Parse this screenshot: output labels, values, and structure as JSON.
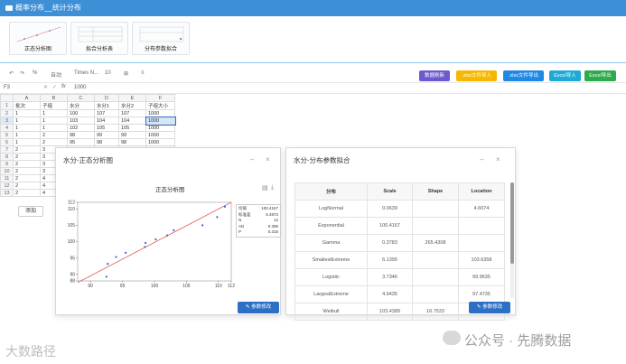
{
  "window_title": "概率分布__统计分布",
  "cards": [
    {
      "label": "正态分析图"
    },
    {
      "label": "拟合分析表"
    },
    {
      "label": "分布参数拟合"
    }
  ],
  "toolbar": {
    "font_name": "Times N...",
    "font_size": "10",
    "auto_label": "自动",
    "percent": "%"
  },
  "buttons": {
    "refresh": "数据刷新",
    "xlsx_import": ".xlsx文件导入",
    "xlsx_export": ".xlsx文件导出",
    "excel_import": "Excel导入",
    "excel_export": "Excel导出"
  },
  "formula_bar": {
    "cell_ref": "F3",
    "value": "1000"
  },
  "sheet": {
    "columns": [
      "A",
      "B",
      "C",
      "D",
      "E",
      "F"
    ],
    "header": [
      "批次",
      "子组",
      "水分",
      "水分1",
      "水分2",
      "子组大小"
    ],
    "rows": [
      [
        "1",
        "1",
        "100",
        "107",
        "107",
        "1000"
      ],
      [
        "1",
        "1",
        "103",
        "104",
        "104",
        "1000"
      ],
      [
        "1",
        "1",
        "102",
        "105",
        "105",
        "1000"
      ],
      [
        "1",
        "2",
        "98",
        "99",
        "99",
        "1000"
      ],
      [
        "1",
        "2",
        "95",
        "98",
        "98",
        "1000"
      ],
      [
        "2",
        "",
        "",
        "",
        "",
        ""
      ],
      [
        "2",
        "",
        "",
        "",
        "",
        ""
      ],
      [
        "2",
        "",
        "",
        "",
        "",
        ""
      ],
      [
        "2",
        "",
        "",
        "",
        "",
        ""
      ],
      [
        "2",
        "",
        "",
        "",
        "",
        ""
      ],
      [
        "2",
        "",
        "",
        "",
        "",
        ""
      ],
      [
        "2",
        "",
        "",
        "",
        "",
        ""
      ]
    ],
    "col_b_extra": [
      "3",
      "3",
      "3",
      "3",
      "4",
      "4",
      "4"
    ],
    "row_numbers": [
      "1",
      "2",
      "3",
      "4",
      "5",
      "6",
      "7",
      "8",
      "9",
      "10",
      "11",
      "12",
      "13"
    ],
    "add_button": "添加"
  },
  "panel_left": {
    "title": "水分-正态分析图",
    "chart_title": "正态分析图",
    "edit_button": "参数修改",
    "min_icon": "minimize-icon",
    "close_icon": "close-icon",
    "stats": [
      {
        "label": "均值",
        "value": "100.4167"
      },
      {
        "label": "标准差",
        "value": "6.4872"
      },
      {
        "label": "N",
        "value": "12"
      },
      {
        "label": "AD",
        "value": "0.395"
      },
      {
        "label": "P",
        "value": "0.315"
      }
    ]
  },
  "chart_data": {
    "type": "scatter",
    "title": "正态分析图",
    "xlim": [
      88,
      112
    ],
    "ylim": [
      88,
      112
    ],
    "x_ticks": [
      "90",
      "95",
      "100",
      "105",
      "110",
      "112"
    ],
    "y_ticks": [
      "88",
      "90",
      "95",
      "100",
      "105",
      "110",
      "112"
    ],
    "points": [
      {
        "x": 92.5,
        "y": 89.3
      },
      {
        "x": 92.7,
        "y": 93.2
      },
      {
        "x": 94.0,
        "y": 95.3
      },
      {
        "x": 95.5,
        "y": 96.6
      },
      {
        "x": 98.5,
        "y": 98.4
      },
      {
        "x": 98.6,
        "y": 99.6
      },
      {
        "x": 100.2,
        "y": 100.7
      },
      {
        "x": 102.0,
        "y": 101.9
      },
      {
        "x": 103.0,
        "y": 103.5
      },
      {
        "x": 107.5,
        "y": 105.0
      },
      {
        "x": 109.8,
        "y": 107.5
      },
      {
        "x": 111.0,
        "y": 110.7
      }
    ],
    "fit_line": [
      {
        "x": 88,
        "y": 87.5
      },
      {
        "x": 112,
        "y": 112
      }
    ],
    "point_color": "#3b5fd9",
    "line_color": "#e53935"
  },
  "panel_right": {
    "title": "水分-分布参数拟合",
    "edit_button": "参数修改",
    "columns": [
      "分布",
      "Scale",
      "Shape",
      "Location"
    ],
    "rows": [
      [
        "LogNormal",
        "0.0639",
        "",
        "4.6074"
      ],
      [
        "Exponential",
        "100.4167",
        "",
        ""
      ],
      [
        "Gamma",
        "0.3783",
        "265.4308",
        ""
      ],
      [
        "SmallestExtreme",
        "6.1395",
        "",
        "103.6358"
      ],
      [
        "Logistic",
        "3.7346",
        "",
        "99.9635"
      ],
      [
        "LargestExtreme",
        "4.9435",
        "",
        "97.4735"
      ],
      [
        "Weibull",
        "103.4389",
        "16.7533",
        ""
      ]
    ]
  },
  "watermarks": {
    "left": "大数路径",
    "right": "公众号 · 先腾数据"
  },
  "colors": {
    "title_bar": "#3d8fd6",
    "refresh": "#6a5acd",
    "xlsx_import": "#f5b800",
    "xlsx_export": "#1e88e5",
    "excel_import": "#1faad6",
    "excel_export": "#2eaa4a",
    "edit_button": "#2d6fc5"
  }
}
